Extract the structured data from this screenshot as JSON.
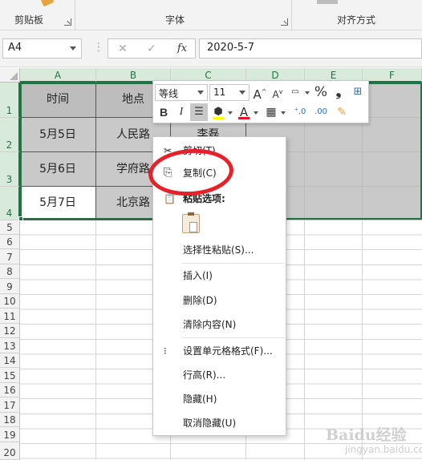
{
  "ribbon": {
    "groups": [
      "剪贴板",
      "字体",
      "对齐方式"
    ]
  },
  "formula_bar": {
    "name_box": "A4",
    "formula": "2020-5-7",
    "fx_label": "fx"
  },
  "columns": [
    "A",
    "B",
    "C",
    "D",
    "E",
    "F"
  ],
  "rows": [
    "1",
    "2",
    "3",
    "4",
    "5",
    "6",
    "7",
    "8",
    "9",
    "10",
    "11",
    "12",
    "13",
    "14",
    "15",
    "16",
    "17",
    "18",
    "19",
    "20"
  ],
  "cells": {
    "A1": "时间",
    "B1": "地点",
    "A2": "5月5日",
    "B2": "人民路",
    "C2": "李磊",
    "A3": "5月6日",
    "B3": "学府路",
    "A4": "5月7日",
    "B4": "北京路"
  },
  "mini_toolbar": {
    "font_name": "等线",
    "font_size": "11",
    "bold": "B",
    "italic": "I",
    "percent": "%",
    "comma": "❟"
  },
  "context_menu": {
    "cut": "剪切(T)",
    "copy": "复制(C)",
    "paste_options": "粘贴选项:",
    "paste_special": "选择性粘贴(S)...",
    "insert": "插入(I)",
    "delete": "删除(D)",
    "clear": "清除内容(N)",
    "format_cells": "设置单元格格式(F)...",
    "row_height": "行高(R)...",
    "hide": "隐藏(H)",
    "unhide": "取消隐藏(U)"
  },
  "colors": {
    "excel_green": "#217346",
    "annotation_red": "#e8202a",
    "selection_gray": "#c9c9c9"
  },
  "watermark": {
    "text1": "Baidu经验",
    "text2": "jingyan.baidu.com"
  }
}
